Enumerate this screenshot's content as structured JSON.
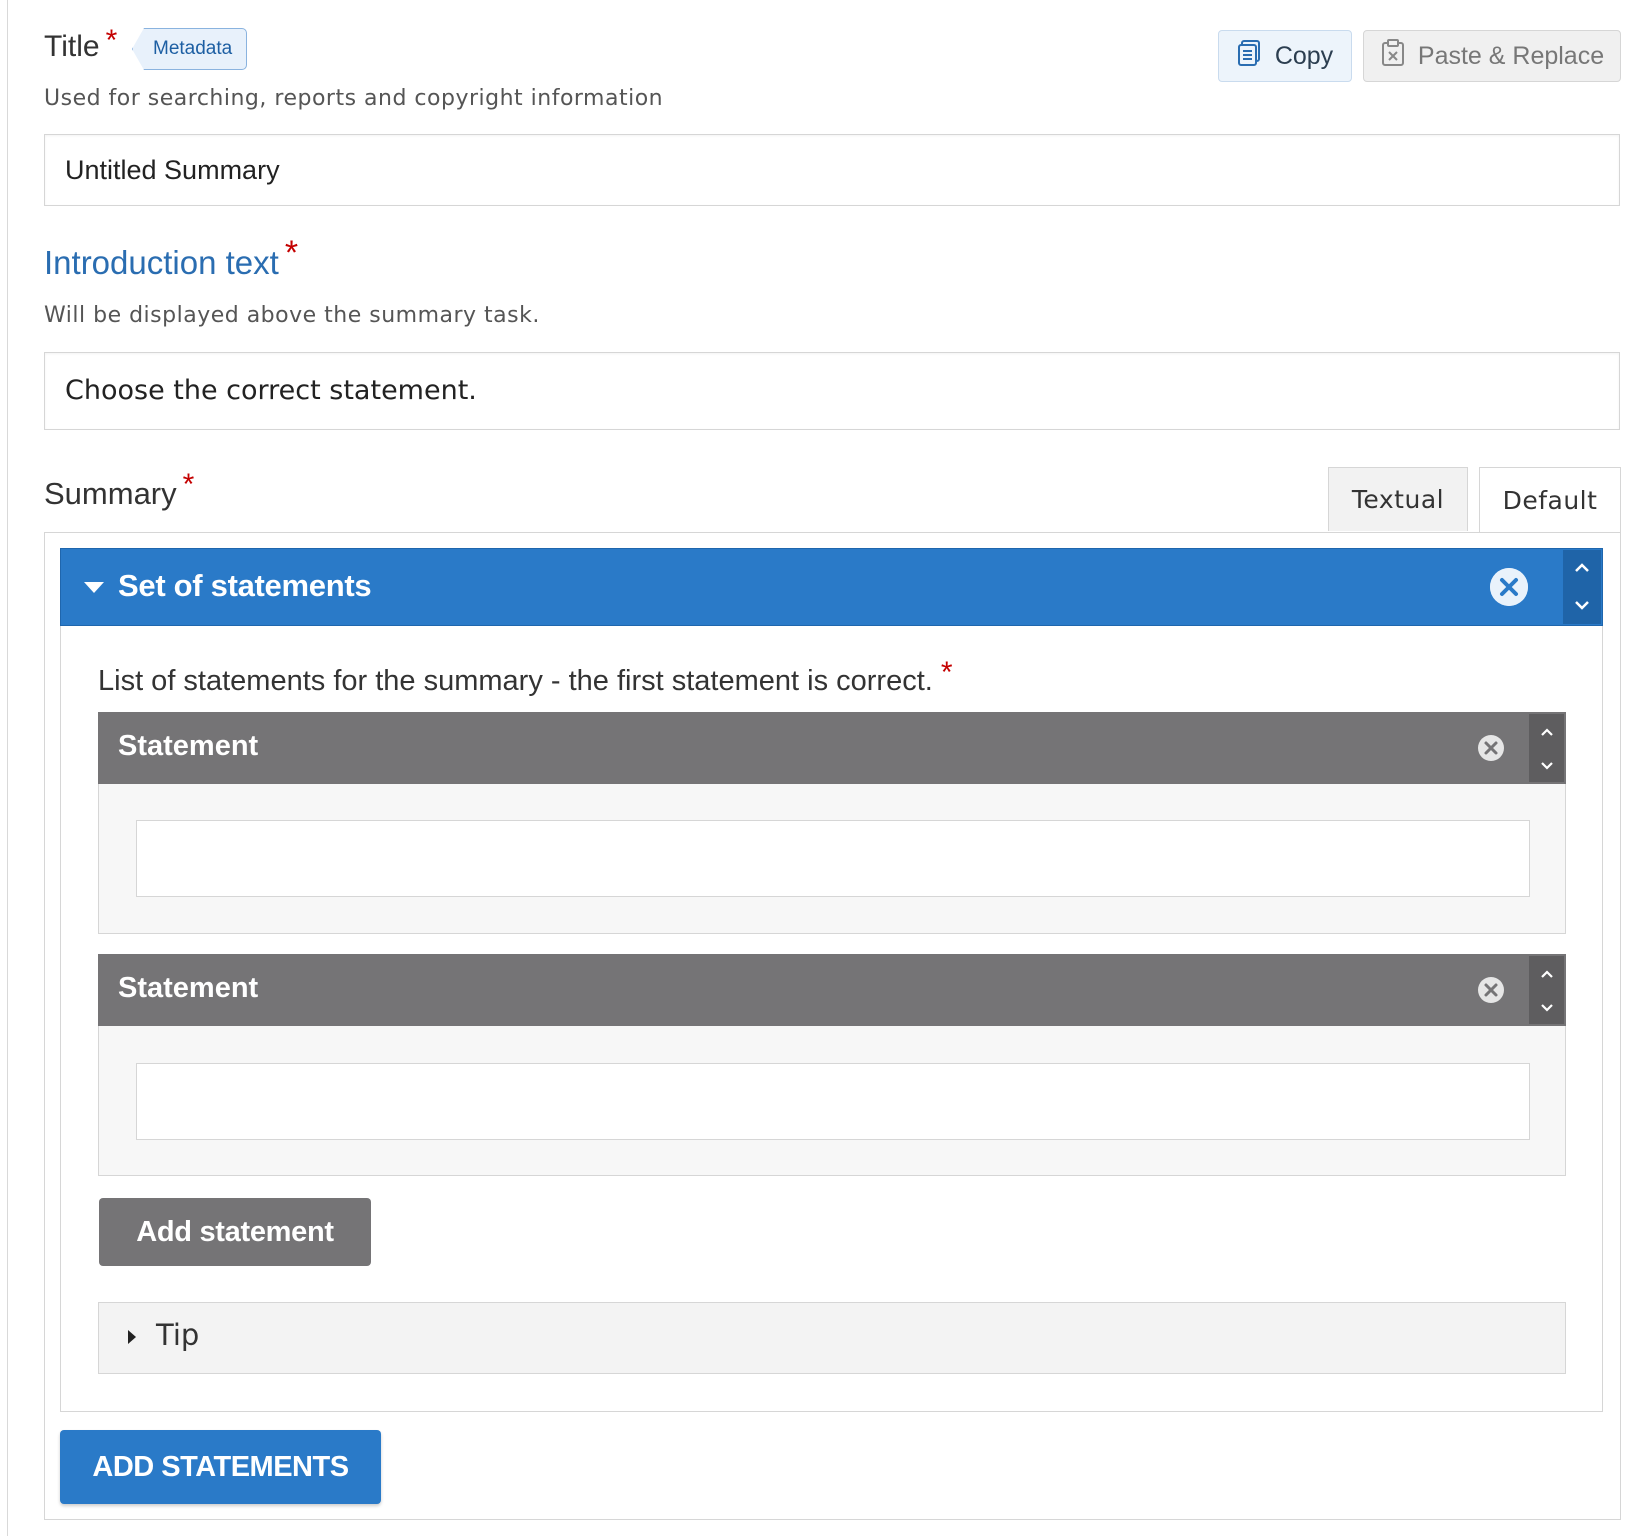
{
  "title_field": {
    "label": "Title",
    "required_mark": "*",
    "metadata_label": "Metadata",
    "description": "Used for searching, reports and copyright information",
    "value": "Untitled Summary"
  },
  "actions": {
    "copy_label": "Copy",
    "paste_label": "Paste & Replace"
  },
  "intro_field": {
    "label": "Introduction text",
    "required_mark": "*",
    "description": "Will be displayed above the summary task.",
    "value": "Choose the correct statement."
  },
  "summary_field": {
    "label": "Summary",
    "required_mark": "*",
    "tabs": [
      "Textual",
      "Default"
    ],
    "active_tab": "Default"
  },
  "group": {
    "title": "Set of statements",
    "list_label": "List of statements for the summary - the first statement is correct.",
    "required_mark": "*",
    "statements": [
      {
        "title": "Statement",
        "value": ""
      },
      {
        "title": "Statement",
        "value": ""
      }
    ],
    "add_statement_label": "Add statement",
    "tip_label": "Tip"
  },
  "add_statements_label": "ADD STATEMENTS",
  "colors": {
    "primary": "#2a7ac8",
    "statement_header": "#757476",
    "required": "#c40000",
    "intro_label": "#2a6db1"
  }
}
